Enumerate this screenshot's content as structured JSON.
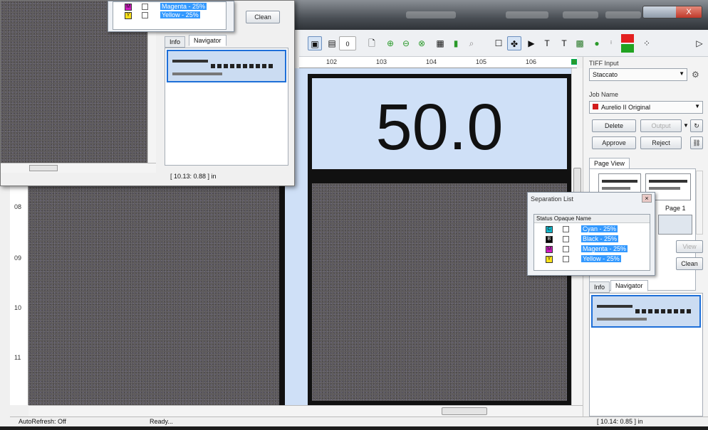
{
  "window": {
    "close_label": "X"
  },
  "toolbar": {
    "page_field": "0"
  },
  "ruler": {
    "h_ticks": [
      "102",
      "103",
      "104",
      "105",
      "106"
    ],
    "v_ticks": [
      "08",
      "09",
      "10",
      "11"
    ]
  },
  "preview": {
    "big_value": "50.0"
  },
  "status": {
    "autorefresh": "AutoRefresh: Off",
    "ready": "Ready...",
    "coords": "[ 10.14: 0.85 ] in",
    "snip_coords": "[ 10.13: 0.88 ] in"
  },
  "panel": {
    "tiff_input_label": "TIFF Input",
    "tiff_input_value": "Staccato",
    "job_name_label": "Job Name",
    "job_name_value": "Aurelio II Original",
    "delete": "Delete",
    "output": "Output",
    "approve": "Approve",
    "reject": "Reject",
    "page_view_tab": "Page View",
    "page_label": "Page 1",
    "view": "View",
    "clean": "Clean",
    "info_tab": "Info",
    "navigator_tab": "Navigator"
  },
  "separation_list": {
    "title": "Separation List",
    "header": "Status Opaque Name",
    "rows": [
      {
        "chip": "C",
        "color": "#12b5c9",
        "name": "Cyan - 25%"
      },
      {
        "chip": "B",
        "color": "#000000",
        "name": "Black - 25%"
      },
      {
        "chip": "M",
        "color": "#d41dc4",
        "name": "Magenta - 25%"
      },
      {
        "chip": "Y",
        "color": "#ffe21a",
        "name": "Yellow - 25%"
      }
    ]
  },
  "snippet": {
    "rows": [
      {
        "chip": "M",
        "color": "#d41dc4",
        "name": "Magenta - 25%"
      },
      {
        "chip": "Y",
        "color": "#ffe21a",
        "name": "Yellow - 25%"
      }
    ],
    "clean": "Clean",
    "info_tab": "Info",
    "navigator_tab": "Navigator"
  }
}
